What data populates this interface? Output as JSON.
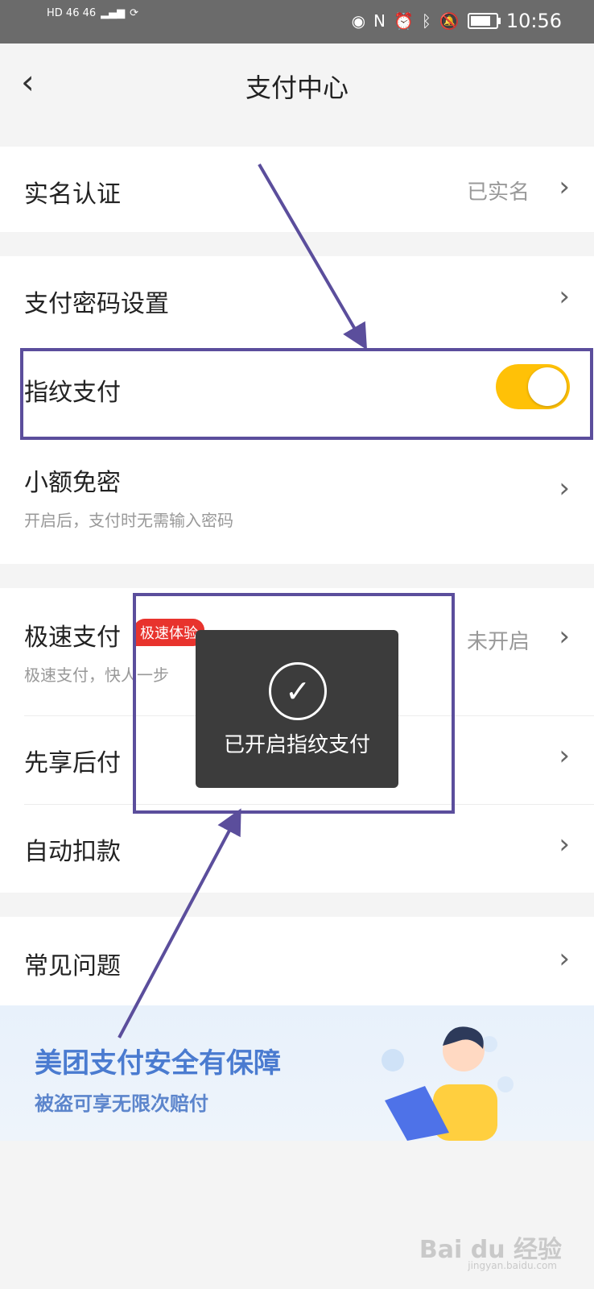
{
  "status_bar": {
    "network_left": "HD 46 46",
    "time": "10:56",
    "icons": [
      "eye-icon",
      "nfc-icon",
      "alarm-icon",
      "bluetooth-icon",
      "mute-icon",
      "battery-icon"
    ]
  },
  "header": {
    "back_icon": "chevron-left-icon",
    "title": "支付中心"
  },
  "rows": {
    "real_name": {
      "label": "实名认证",
      "value": "已实名"
    },
    "password": {
      "label": "支付密码设置"
    },
    "fingerprint": {
      "label": "指纹支付",
      "enabled": true
    },
    "small_amount": {
      "label": "小额免密",
      "sub": "开启后，支付时无需输入密码"
    },
    "quick_pay": {
      "label": "极速支付",
      "badge": "极速体验",
      "sub": "极速支付，快人一步",
      "value": "未开启"
    },
    "pay_later": {
      "label": "先享后付"
    },
    "auto_debit": {
      "label": "自动扣款"
    },
    "faq": {
      "label": "常见问题"
    }
  },
  "toast": {
    "message": "已开启指纹支付",
    "icon": "checkmark-circle-icon"
  },
  "banner": {
    "title": "美团支付安全有保障",
    "subtitle": "被盗可享无限次赔付"
  },
  "watermark": {
    "text": "Bai du 经验",
    "sub": "jingyan.baidu.com"
  },
  "colors": {
    "toggle_on": "#ffc107",
    "badge": "#e8332d",
    "annotation": "#5b4e9c",
    "banner_text": "#4a7bd0"
  }
}
